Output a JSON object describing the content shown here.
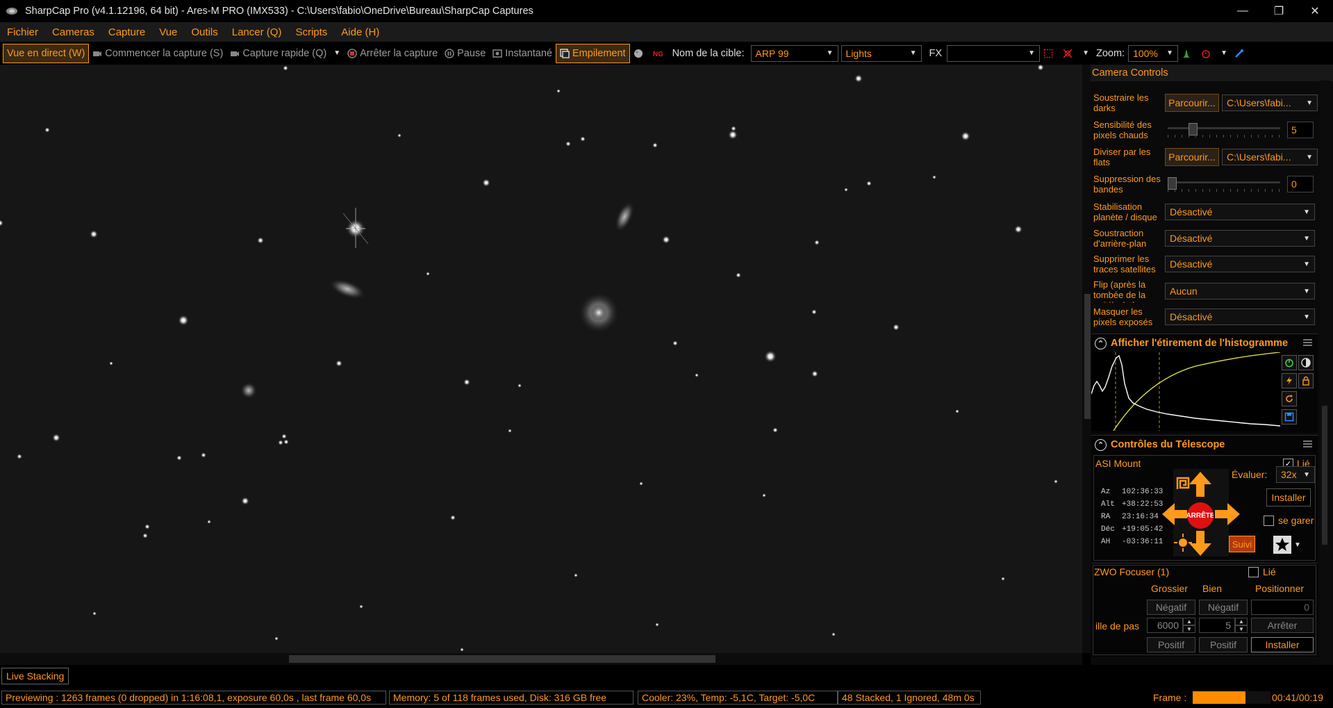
{
  "window": {
    "title": "SharpCap Pro (v4.1.12196, 64 bit) - Ares-M PRO (IMX533) - C:\\Users\\fabio\\OneDrive\\Bureau\\SharpCap Captures"
  },
  "menu": [
    "Fichier",
    "Cameras",
    "Capture",
    "Vue",
    "Outils",
    "Lancer (Q)",
    "Scripts",
    "Aide (H)"
  ],
  "toolbar": {
    "live_view": "Vue en direct (W)",
    "start_capture": "Commencer la capture (S)",
    "quick_capture": "Capture rapide (Q)",
    "stop_capture": "Arrêter la capture",
    "pause": "Pause",
    "snapshot": "Instantané",
    "stacking": "Empilement",
    "target_label": "Nom de la cible:",
    "target_value": "ARP 99",
    "frame_type": "Lights",
    "fx_label": "FX",
    "fx_value": "",
    "zoom_label": "Zoom:",
    "zoom_value": "100%"
  },
  "panel": {
    "title": "Camera Controls",
    "processing": {
      "subtract_darks": {
        "label": "Soustraire les darks",
        "button": "Parcourir...",
        "path": "C:\\Users\\fabi..."
      },
      "hot_pixel": {
        "label": "Sensibilité des pixels chauds",
        "value": "5",
        "level": 0.2
      },
      "divide_flats": {
        "label": "Diviser par les flats",
        "button": "Parcourir...",
        "path": "C:\\Users\\fabi..."
      },
      "banding": {
        "label": "Suppression des bandes",
        "value": "0",
        "level": 0.0
      },
      "stabilisation": {
        "label": "Stabilisation planète / disque",
        "value": "Désactivé"
      },
      "background": {
        "label": "Soustraction d'arrière-plan",
        "value": "Désactivé"
      },
      "satellites": {
        "label": "Supprimer les traces satellites",
        "value": "Désactivé"
      },
      "flip": {
        "label": "Flip (après la tombée de la nuit/à plat)",
        "value": "Aucun"
      },
      "mask": {
        "label": "Masquer les pixels exposés",
        "value": "Désactivé"
      }
    },
    "histogram": {
      "title": "Afficher l'étirement de l'histogramme"
    },
    "telescope": {
      "title": "Contrôles du Télescope",
      "mount": "ASI Mount",
      "linked_label": "Lié",
      "rate_label": "Évaluer:",
      "rate_value": "32x",
      "install": "Installer",
      "stop": "ARRÊTE",
      "park_label": "se garer",
      "track": "Suivi",
      "coords": [
        {
          "k": "Az",
          "v": "102:36:33"
        },
        {
          "k": "Alt",
          "v": "+38:22:53"
        },
        {
          "k": "RA",
          "v": "23:16:34"
        },
        {
          "k": "Déc",
          "v": "+19:05:42"
        },
        {
          "k": "AH",
          "v": "-03:36:11"
        }
      ]
    },
    "focuser": {
      "title": "ZWO Focuser (1)",
      "linked_label": "Lié",
      "col_coarse": "Grossier",
      "col_fine": "Bien",
      "col_position": "Positionner",
      "neg": "Négatif",
      "pos": "Positif",
      "position_value": "0",
      "step_label": "ille de pas",
      "coarse_step": "6000",
      "fine_step": "5",
      "stop": "Arrêter",
      "install": "Installer"
    }
  },
  "tab": {
    "live_stacking": "Live Stacking"
  },
  "status": {
    "preview": "Previewing : 1263 frames (0 dropped) in 1:16:08,1, exposure 60,0s , last frame 60,0s",
    "memory": "Memory: 5 of 118 frames used, Disk: 316 GB free",
    "cooler": "Cooler: 23%, Temp: -5,1C, Target: -5,0C",
    "stack": "48 Stacked, 1 Ignored, 48m 0s",
    "frame_label": "Frame :",
    "frame_progress": 0.68,
    "frame_time": "00:41/00:19"
  },
  "colors": {
    "accent": "#ff9a1a",
    "background": "#000000",
    "stop_button": "#e01010"
  }
}
